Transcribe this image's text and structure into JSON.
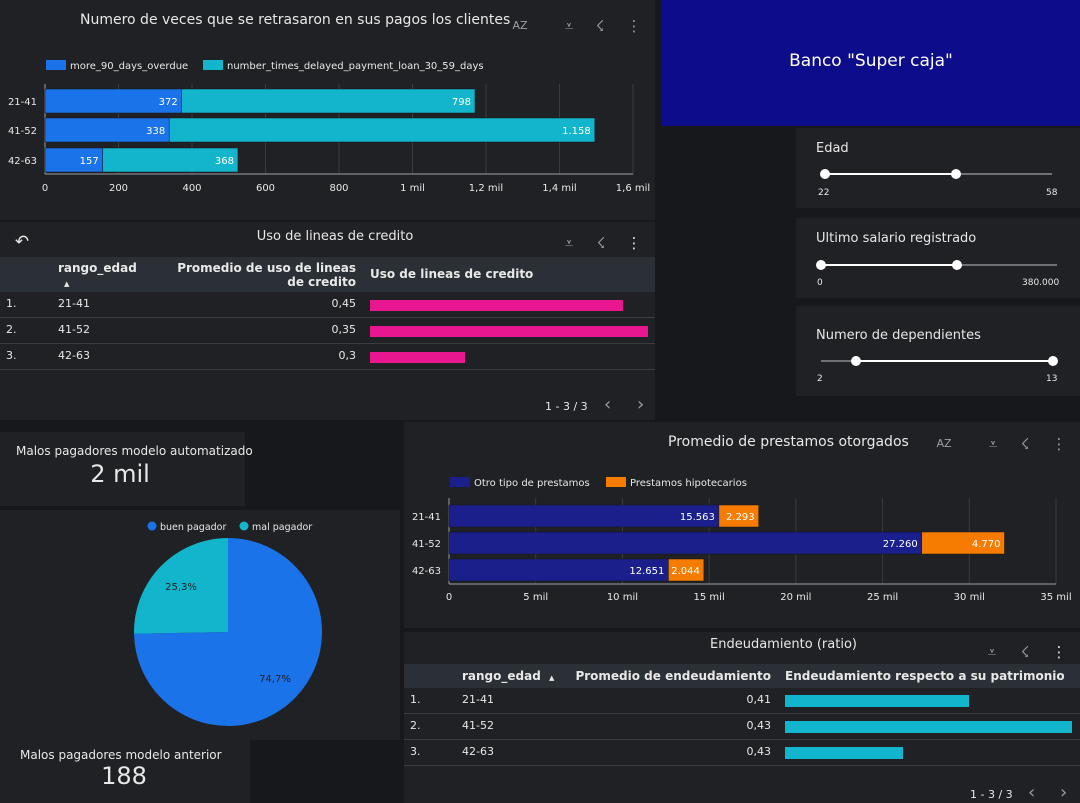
{
  "charts": {
    "delays": {
      "title": "Numero de veces que se retrasaron en sus pagos los clientes",
      "legend": [
        "more_90_days_overdue",
        "number_times_delayed_payment_loan_30_59_days"
      ],
      "categories": [
        "21-41",
        "41-52",
        "42-63"
      ],
      "ticks": [
        "0",
        "200",
        "400",
        "600",
        "800",
        "1 mil",
        "1,2 mil",
        "1,4 mil",
        "1,6 mil"
      ],
      "value_labels_a": [
        "372",
        "338",
        "157"
      ],
      "value_labels_b": [
        "798",
        "1.158",
        "368"
      ]
    },
    "loans": {
      "title": "Promedio de prestamos otorgados",
      "legend": [
        "Otro tipo de prestamos",
        "Prestamos hipotecarios"
      ],
      "categories": [
        "21-41",
        "41-52",
        "42-63"
      ],
      "ticks": [
        "0",
        "5 mil",
        "10 mil",
        "15 mil",
        "20 mil",
        "25 mil",
        "30 mil",
        "35 mil"
      ],
      "value_labels_a": [
        "15.563",
        "27.260",
        "12.651"
      ],
      "value_labels_b": [
        "2.293",
        "4.770",
        "2.044"
      ]
    },
    "pie": {
      "legend": [
        "buen pagador",
        "mal pagador"
      ],
      "labels": [
        "74,7%",
        "25,3%"
      ]
    }
  },
  "chart_data": [
    {
      "type": "bar",
      "orientation": "horizontal",
      "stacked": true,
      "title": "Numero de veces que se retrasaron en sus pagos los clientes",
      "categories": [
        "21-41",
        "41-52",
        "42-63"
      ],
      "series": [
        {
          "name": "more_90_days_overdue",
          "values": [
            372,
            338,
            157
          ],
          "color": "#1a73e8"
        },
        {
          "name": "number_times_delayed_payment_loan_30_59_days",
          "values": [
            798,
            1158,
            368
          ],
          "color": "#12b5cb"
        }
      ],
      "xlim": [
        0,
        1600
      ],
      "grid": true,
      "legend_position": "top"
    },
    {
      "type": "bar",
      "orientation": "horizontal",
      "stacked": true,
      "title": "Promedio de prestamos otorgados",
      "categories": [
        "21-41",
        "41-52",
        "42-63"
      ],
      "series": [
        {
          "name": "Otro tipo de prestamos",
          "values": [
            15563,
            27260,
            12651
          ],
          "color": "#1a1f8c"
        },
        {
          "name": "Prestamos hipotecarios",
          "values": [
            2293,
            4770,
            2044
          ],
          "color": "#f57c00"
        }
      ],
      "xlim": [
        0,
        35000
      ],
      "grid": true,
      "legend_position": "top"
    },
    {
      "type": "pie",
      "series": [
        {
          "values": [
            74.7,
            25.3
          ]
        }
      ],
      "categories": [
        "buen pagador",
        "mal pagador"
      ],
      "colors": [
        "#1a73e8",
        "#12b5cb"
      ],
      "legend_position": "top"
    },
    {
      "type": "table",
      "title": "Uso de lineas de credito",
      "columns": [
        "rango_edad",
        "Promedio de uso de lineas de credito",
        "Uso de lineas de credito"
      ],
      "rows": [
        [
          "21-41",
          0.45
        ],
        [
          "41-52",
          0.35
        ],
        [
          "42-63",
          0.3
        ]
      ]
    },
    {
      "type": "table",
      "title": "Endeudamiento (ratio)",
      "columns": [
        "rango_edad",
        "Promedio de endeudamiento",
        "Endeudamiento respecto a su patrimonio"
      ],
      "rows": [
        [
          "21-41",
          0.41
        ],
        [
          "41-52",
          0.43
        ],
        [
          "42-63",
          0.43
        ]
      ]
    }
  ],
  "bank": {
    "name": "Banco \"Super caja\""
  },
  "tables": {
    "credit": {
      "title": "Uso de lineas de credito",
      "col1": "rango_edad",
      "col2": "Promedio de uso de lineas de credito",
      "col3": "Uso de lineas de credito",
      "rows": [
        {
          "idx": "1.",
          "range": "21-41",
          "value": "0,45",
          "bar": 0.91
        },
        {
          "idx": "2.",
          "range": "41-52",
          "value": "0,35",
          "bar": 1.0
        },
        {
          "idx": "3.",
          "range": "42-63",
          "value": "0,3",
          "bar": 0.34
        }
      ],
      "pager": "1 - 3 / 3"
    },
    "debt": {
      "title": "Endeudamiento (ratio)",
      "col1": "rango_edad",
      "col2": "Promedio de endeudamiento",
      "col3": "Endeudamiento respecto a su patrimonio",
      "rows": [
        {
          "idx": "1.",
          "range": "21-41",
          "value": "0,41",
          "bar": 0.64
        },
        {
          "idx": "2.",
          "range": "41-52",
          "value": "0,43",
          "bar": 1.0
        },
        {
          "idx": "3.",
          "range": "42-63",
          "value": "0,43",
          "bar": 0.41
        }
      ],
      "pager": "1 - 3 / 3"
    }
  },
  "scorecards": {
    "auto": {
      "label": "Malos pagadores modelo automatizado",
      "value": "2 mil"
    },
    "prev": {
      "label": "Malos pagadores modelo anterior",
      "value": "188"
    }
  },
  "filters": {
    "age": {
      "label": "Edad",
      "min": "22",
      "max": "58",
      "lo": 0.0,
      "hi": 0.58
    },
    "salary": {
      "label": "Ultimo salario registrado",
      "min": "0",
      "max": "380.000",
      "lo": 0.0,
      "hi": 0.58
    },
    "dependents": {
      "label": "Numero de dependientes",
      "min": "2",
      "max": "13",
      "lo": 0.15,
      "hi": 1.0
    }
  },
  "icons": {
    "sort": "AZ",
    "filter": "⩡",
    "crossfilter": "☇",
    "more": "⋮",
    "undo": "↶",
    "prev": "‹",
    "next": "›"
  },
  "colors": {
    "bank_bg": "#0d0d8c",
    "blue": "#1a73e8",
    "teal": "#12b5cb",
    "navy": "#1a1f8c",
    "orange": "#f57c00",
    "pink": "#e8168f",
    "cyan_bar": "#12b5cb"
  }
}
